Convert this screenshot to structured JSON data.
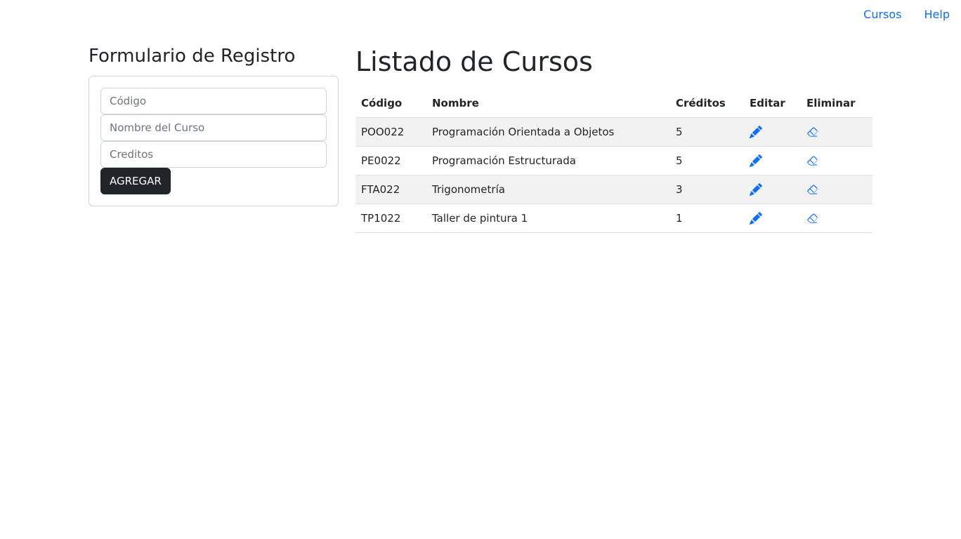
{
  "nav": {
    "links": [
      "Cursos",
      "Help"
    ]
  },
  "form": {
    "title": "Formulario de Registro",
    "codigo_placeholder": "Código",
    "nombre_placeholder": "Nombre del Curso",
    "creditos_placeholder": "Creditos",
    "submit_label": "AGREGAR"
  },
  "list": {
    "title": "Listado de Cursos",
    "headers": [
      "Código",
      "Nombre",
      "Créditos",
      "Editar",
      "Eliminar"
    ],
    "rows": [
      {
        "codigo": "POO022",
        "nombre": "Programación Orientada a Objetos",
        "creditos": "5"
      },
      {
        "codigo": "PE0022",
        "nombre": "Programación Estructurada",
        "creditos": "5"
      },
      {
        "codigo": "FTA022",
        "nombre": "Trigonometría",
        "creditos": "3"
      },
      {
        "codigo": "TP1022",
        "nombre": "Taller de pintura 1",
        "creditos": "1"
      }
    ]
  },
  "icons": {
    "edit": "pencil-icon",
    "delete": "eraser-icon"
  },
  "colors": {
    "link": "#0d6efd",
    "button_bg": "#212529",
    "stripe": "#f2f2f2"
  }
}
